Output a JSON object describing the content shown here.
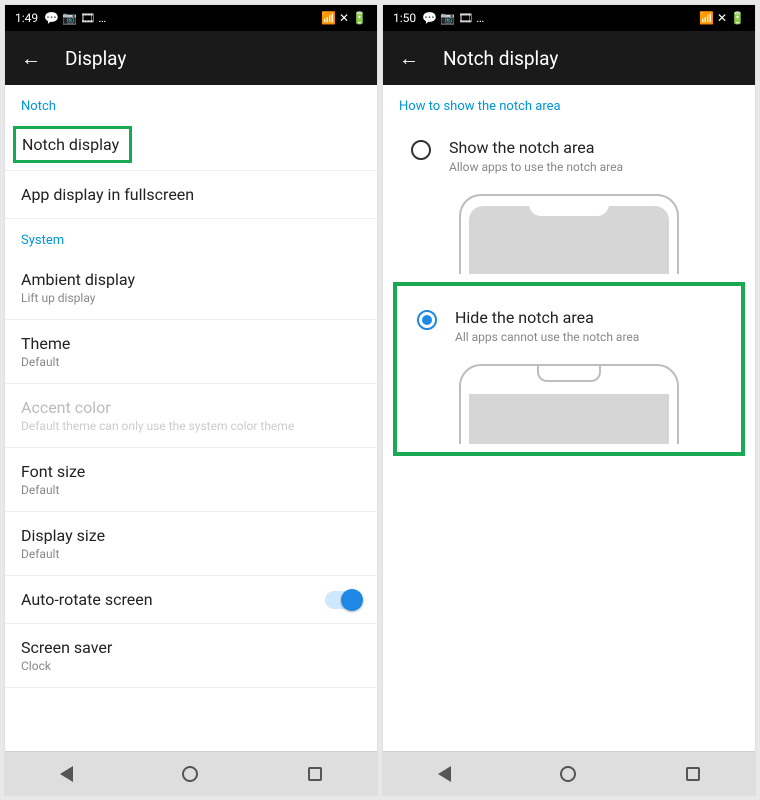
{
  "left": {
    "status": {
      "time": "1:49",
      "icons": "💬 📷 🎞 …",
      "right_icons": "📶 ✕ 🔋"
    },
    "appbar": {
      "title": "Display"
    },
    "section_notch": "Notch",
    "notch_display": "Notch display",
    "app_display": "App display in fullscreen",
    "section_system": "System",
    "ambient": {
      "t": "Ambient display",
      "s": "Lift up display"
    },
    "theme": {
      "t": "Theme",
      "s": "Default"
    },
    "accent": {
      "t": "Accent color",
      "s": "Default theme can only use the system color theme"
    },
    "font": {
      "t": "Font size",
      "s": "Default"
    },
    "display_size": {
      "t": "Display size",
      "s": "Default"
    },
    "autorotate": "Auto-rotate screen",
    "screensaver": {
      "t": "Screen saver",
      "s": "Clock"
    }
  },
  "right": {
    "status": {
      "time": "1:50",
      "icons": "💬 📷 🎞 …",
      "right_icons": "📶 ✕ 🔋"
    },
    "appbar": {
      "title": "Notch display"
    },
    "section": "How to show the notch area",
    "show": {
      "t": "Show the notch area",
      "s": "Allow apps to use the notch area"
    },
    "hide": {
      "t": "Hide the notch area",
      "s": "All apps cannot use the notch area"
    }
  }
}
